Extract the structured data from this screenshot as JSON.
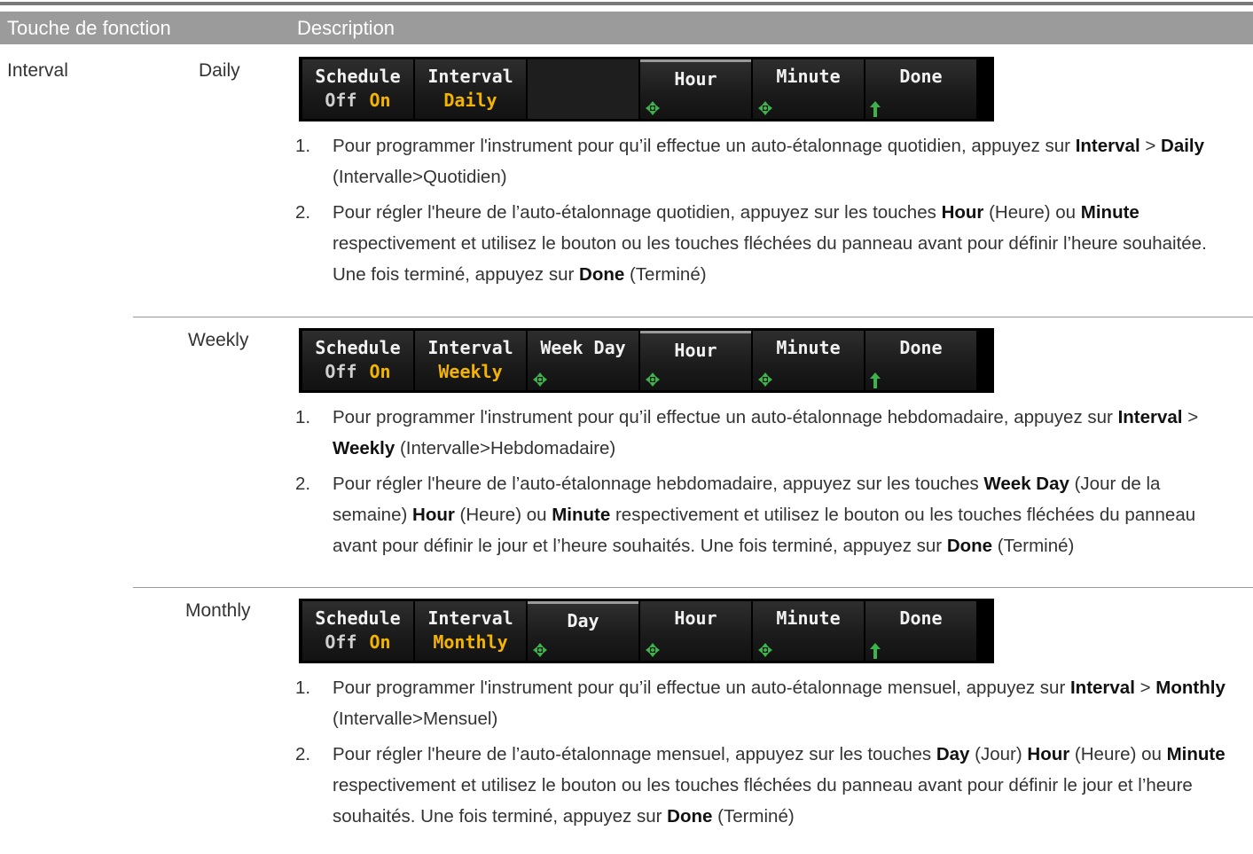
{
  "header": {
    "col1": "Touche de fonction",
    "col2": "Description"
  },
  "key_label": "Interval",
  "rows": [
    {
      "label": "Daily",
      "softkeys": {
        "schedule_t1": "Schedule",
        "schedule_off": "Off",
        "schedule_on": "On",
        "interval_t1": "Interval",
        "interval_val": "Daily",
        "k3": "",
        "hour": "Hour",
        "minute": "Minute",
        "done": "Done"
      },
      "s1": {
        "num": "1.",
        "a": "Pour programmer l'instrument pour qu’il effectue un auto-étalonnage quotidien, appuyez sur ",
        "b1": "Interval",
        "c": " > ",
        "b2": "Daily",
        "d": " (Intervalle>Quotidien)"
      },
      "s2": {
        "num": "2.",
        "a": "Pour régler l'heure de l’auto-étalonnage quotidien, appuyez sur les touches ",
        "b1": "Hour",
        "c": " (Heure) ou ",
        "b2": "Minute",
        "d": " respectivement et utilisez le bouton ou les touches fléchées du panneau avant pour définir l’heure souhaitée. Une fois terminé, appuyez sur ",
        "b3": "Done",
        "e": " (Terminé)"
      }
    },
    {
      "label": "Weekly",
      "softkeys": {
        "schedule_t1": "Schedule",
        "schedule_off": "Off",
        "schedule_on": "On",
        "interval_t1": "Interval",
        "interval_val": "Weekly",
        "k3": "Week Day",
        "hour": "Hour",
        "minute": "Minute",
        "done": "Done"
      },
      "s1": {
        "num": "1.",
        "a": "Pour programmer l'instrument pour qu’il effectue un auto-étalonnage hebdomadaire, appuyez sur ",
        "b1": "Interval",
        "c": " > ",
        "b2": "Weekly",
        "d": " (Intervalle>Hebdomadaire)"
      },
      "s2": {
        "num": "2.",
        "a": "Pour régler l'heure de l’auto-étalonnage hebdomadaire, appuyez sur les touches ",
        "b1": "Week Day",
        "c": " (Jour de la semaine) ",
        "b2": "Hour",
        "d": " (Heure) ou ",
        "b3": "Minute",
        "e": " respectivement et utilisez le bouton ou les touches fléchées du panneau avant pour définir le jour et l’heure souhaités. Une fois terminé, appuyez sur ",
        "b4": "Done",
        "f": " (Terminé)"
      }
    },
    {
      "label": "Monthly",
      "softkeys": {
        "schedule_t1": "Schedule",
        "schedule_off": "Off",
        "schedule_on": "On",
        "interval_t1": "Interval",
        "interval_val": "Monthly",
        "k3": "Day",
        "hour": "Hour",
        "minute": "Minute",
        "done": "Done"
      },
      "s1": {
        "num": "1.",
        "a": "Pour programmer l'instrument pour qu’il effectue un auto-étalonnage mensuel, appuyez sur ",
        "b1": "Interval",
        "c": " > ",
        "b2": "Monthly",
        "d": " (Intervalle>Mensuel)"
      },
      "s2": {
        "num": "2.",
        "a": "Pour régler l'heure de l’auto-étalonnage mensuel, appuyez sur les touches ",
        "b1": "Day",
        "c": " (Jour) ",
        "b2": "Hour",
        "d": " (Heure) ou ",
        "b3": "Minute",
        "e": " respectivement et utilisez le bouton ou les touches fléchées du panneau avant pour définir le jour et l’heure souhaités. Une fois terminé, appuyez sur ",
        "b4": "Done",
        "f": " (Terminé)"
      }
    }
  ]
}
